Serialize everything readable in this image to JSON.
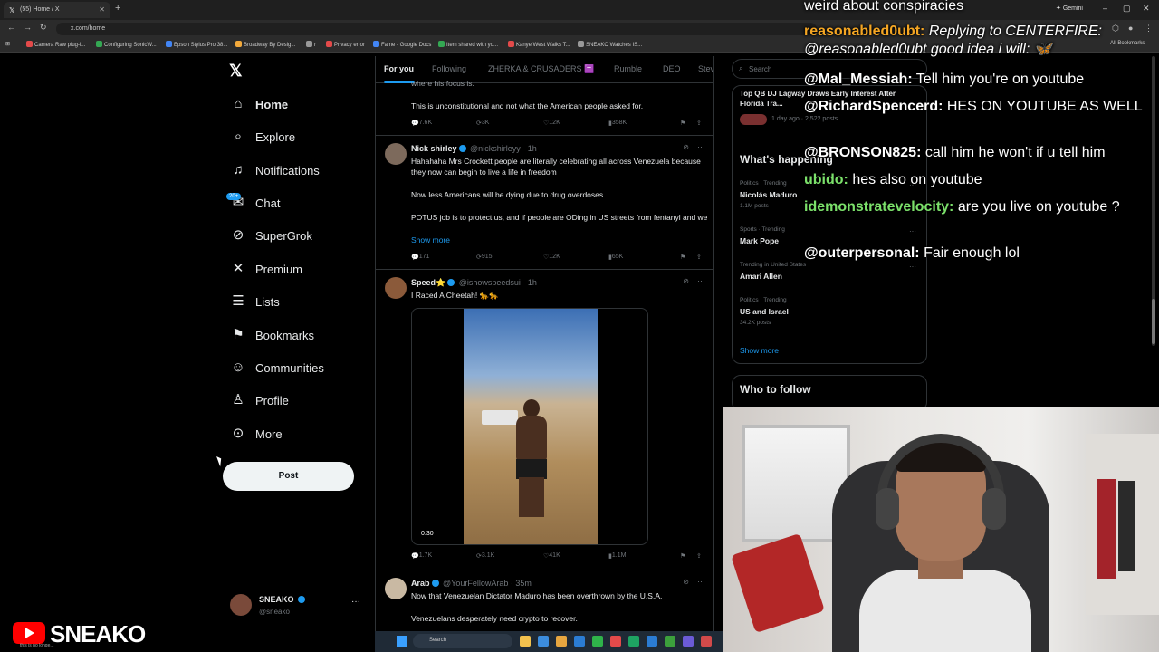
{
  "browser": {
    "tab_title": "(55) Home / X",
    "url": "x.com/home",
    "gemini": "Gemini",
    "bookmarks": [
      {
        "label": "Camera Raw plug-i...",
        "color": "#e34a4a"
      },
      {
        "label": "Configuring SonicW...",
        "color": "#34a853"
      },
      {
        "label": "Epson Stylus Pro 38...",
        "color": "#4285f4"
      },
      {
        "label": "Broadway By Desig...",
        "color": "#f2a93b"
      },
      {
        "label": "r",
        "color": "#999999"
      },
      {
        "label": "Privacy error",
        "color": "#e34a4a"
      },
      {
        "label": "Fame - Google Docs",
        "color": "#4285f4"
      },
      {
        "label": "Item shared with yo...",
        "color": "#34a853"
      },
      {
        "label": "Kanye West Walks T...",
        "color": "#e34a4a"
      },
      {
        "label": "SNEAKO Watches IS...",
        "color": "#999999"
      }
    ],
    "all_bookmarks": "All Bookmarks"
  },
  "nav": {
    "items": [
      {
        "label": "Home",
        "icon": "home-icon"
      },
      {
        "label": "Explore",
        "icon": "search-icon"
      },
      {
        "label": "Notifications",
        "icon": "bell-icon"
      },
      {
        "label": "Chat",
        "icon": "mail-icon"
      },
      {
        "label": "SuperGrok",
        "icon": "grok-icon"
      },
      {
        "label": "Premium",
        "icon": "x-icon"
      },
      {
        "label": "Lists",
        "icon": "list-icon"
      },
      {
        "label": "Bookmarks",
        "icon": "bookmark-icon"
      },
      {
        "label": "Communities",
        "icon": "people-icon"
      },
      {
        "label": "Profile",
        "icon": "person-icon"
      },
      {
        "label": "More",
        "icon": "more-icon"
      }
    ],
    "chat_badge": "20+",
    "post": "Post",
    "account": {
      "name": "SNEAKO",
      "handle": "@sneako"
    }
  },
  "stream": {
    "channel": "SNEAKO",
    "tiny": "this is no longe..."
  },
  "feed": {
    "tabs": [
      "For you",
      "Following",
      "ZHERKA & CRUSADERS ✝️",
      "Rumble",
      "DEO",
      "Stev"
    ],
    "tweets": [
      {
        "text_top": "where his focus is.",
        "text": "This is unconstitutional and not what the American people asked for.",
        "actions": [
          "7.6K",
          "3K",
          "12K",
          "358K"
        ]
      },
      {
        "name": "Nick shirley",
        "handle": "@nickshirleyy · 1h",
        "p1": "Hahahaha Mrs Crockett people are literally celebrating all across Venezuela because they now can begin to live a life in freedom",
        "p2": "Now less Americans will be dying due to drug overdoses.",
        "p3": "POTUS job is to protect us, and if people are ODing in US streets from fentanyl and we",
        "show_more": "Show more",
        "actions": [
          "171",
          "915",
          "12K",
          "65K"
        ]
      },
      {
        "name": "Speed⭐",
        "handle": "@ishowspeedsui · 1h",
        "text": "I Raced A Cheetah! 🐆🐆",
        "duration": "0:30",
        "actions": [
          "1.7K",
          "3.1K",
          "41K",
          "1.1M"
        ]
      },
      {
        "name": "Arab",
        "handle": "@YourFellowArab · 35m",
        "p1": "Now that Venezuelan Dictator Maduro has been overthrown by the U.S.A.",
        "p2": "Venezuelans desperately need crypto to recover."
      }
    ]
  },
  "right": {
    "search_placeholder": "Search",
    "top_story": "Top QB DJ Lagway Draws Early Interest After Florida Tra...",
    "top_story_meta": "1 day ago · 2,522 posts",
    "whats_happening": "What's happening",
    "trends": [
      {
        "cat": "Politics · Trending",
        "name": "Nicolás Maduro",
        "posts": "1.1M posts"
      },
      {
        "cat": "Sports · Trending",
        "name": "Mark Pope",
        "posts": ""
      },
      {
        "cat": "Trending in United States",
        "name": "Amari Allen",
        "posts": ""
      },
      {
        "cat": "Politics · Trending",
        "name": "US and Israel",
        "posts": "34.2K posts"
      }
    ],
    "show_more": "Show more",
    "who_to_follow": "Who to follow"
  },
  "chat": [
    {
      "user": "",
      "msg": "weird about conspiracies",
      "color": "#ffffff"
    },
    {
      "user": "reasonabled0ubt:",
      "msg": "Replying to CENTERFIRE: @reasonabled0ubt good idea i will: 🦋",
      "color": "#f5a623"
    },
    {
      "user": "@Mal_Messiah:",
      "msg": "Tell him you're on youtube",
      "color": "#ffffff"
    },
    {
      "user": "@RichardSpencerd:",
      "msg": "HES ON YOUTUBE AS WELL",
      "color": "#ffffff"
    },
    {
      "user": "@BRONSON825:",
      "msg": "call him he won't if u tell him",
      "color": "#ffffff"
    },
    {
      "user": "ubido:",
      "msg": "hes also on youtube",
      "color": "#7be06a"
    },
    {
      "user": "idemonstratevelocity:",
      "msg": "are you live on youtube ?",
      "color": "#7be06a"
    },
    {
      "user": "@outerpersonal:",
      "msg": "Fair enough lol",
      "color": "#ffffff"
    }
  ],
  "taskbar": {
    "search": "Search"
  }
}
